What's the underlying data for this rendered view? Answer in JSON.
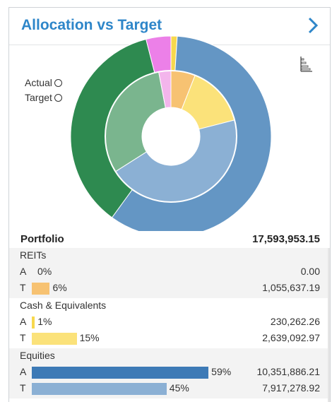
{
  "header": {
    "title": "Allocation vs Target"
  },
  "legend": {
    "actual_label": "Actual",
    "target_label": "Target"
  },
  "portfolio": {
    "label": "Portfolio",
    "value": "17,593,953.15"
  },
  "colors": {
    "accent": "#2e86c9",
    "reits_target": "#f7c272",
    "cash_target": "#fbe27a",
    "cash_actual": "#f7d84d",
    "equities_actual": "#3d7ab6",
    "equities_target": "#8bb0d4",
    "fixed_income_actual": "#2e8a50",
    "fixed_income_target": "#7ab58e",
    "alternatives_actual": "#ec80e8",
    "alternatives_target": "#f3b5ec"
  },
  "rows": [
    {
      "name": "REITs",
      "actual": {
        "code": "A",
        "pct_label": "0%",
        "fraction": 0.0,
        "amount": "0.00",
        "color": "#f4b04d"
      },
      "target": {
        "code": "T",
        "pct_label": "6%",
        "fraction": 0.06,
        "amount": "1,055,637.19",
        "color": "#f7c272"
      }
    },
    {
      "name": "Cash & Equivalents",
      "actual": {
        "code": "A",
        "pct_label": "1%",
        "fraction": 0.01,
        "amount": "230,262.26",
        "color": "#f7d84d"
      },
      "target": {
        "code": "T",
        "pct_label": "15%",
        "fraction": 0.15,
        "amount": "2,639,092.97",
        "color": "#fbe27a"
      }
    },
    {
      "name": "Equities",
      "actual": {
        "code": "A",
        "pct_label": "59%",
        "fraction": 0.59,
        "amount": "10,351,886.21",
        "color": "#3d7ab6"
      },
      "target": {
        "code": "T",
        "pct_label": "45%",
        "fraction": 0.45,
        "amount": "7,917,278.92",
        "color": "#8bb0d4"
      }
    }
  ],
  "chart_data": {
    "type": "pie",
    "series": [
      {
        "name": "Actual",
        "values": [
          0.0,
          1.0,
          59.0,
          36.0,
          4.0
        ],
        "colors": [
          "#f4b04d",
          "#f7d84d",
          "#6496c4",
          "#2e8a50",
          "#ec80e8"
        ]
      },
      {
        "name": "Target",
        "values": [
          6.0,
          15.0,
          45.0,
          31.0,
          3.0
        ],
        "colors": [
          "#f7c272",
          "#fbe27a",
          "#8bb0d4",
          "#7ab58e",
          "#f3b5ec"
        ]
      }
    ]
  }
}
